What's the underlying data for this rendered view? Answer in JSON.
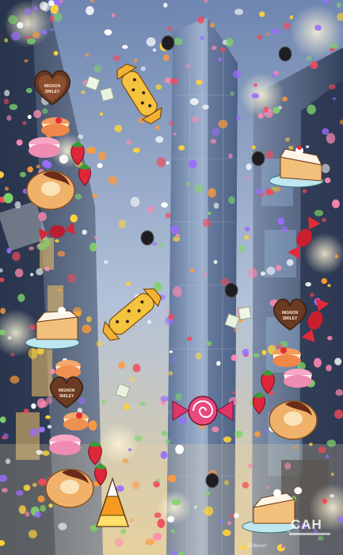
{
  "scene": {
    "description_free": true,
    "sky_top": "#6f86ad",
    "sky_bottom": "#d9c9a8",
    "tower_color": "#7f95b6",
    "confetti_colors": [
      "#f24a5a",
      "#ffd23a",
      "#7fd36a",
      "#ff8ab3",
      "#ffffff",
      "#9b6cff",
      "#ff9a3a"
    ]
  },
  "watermark": {
    "label": "CAH",
    "copyright": "© Marvel"
  },
  "icons": {
    "cookie_heart_text": "MIGNON SMILEY",
    "candy_names": [
      "yellow-wrapped-candy",
      "red-twist-candy",
      "pink-swirl-candy",
      "candy-corn",
      "cake-slice",
      "macaron",
      "strawberry",
      "bundt-cake",
      "heart-cookie"
    ]
  }
}
